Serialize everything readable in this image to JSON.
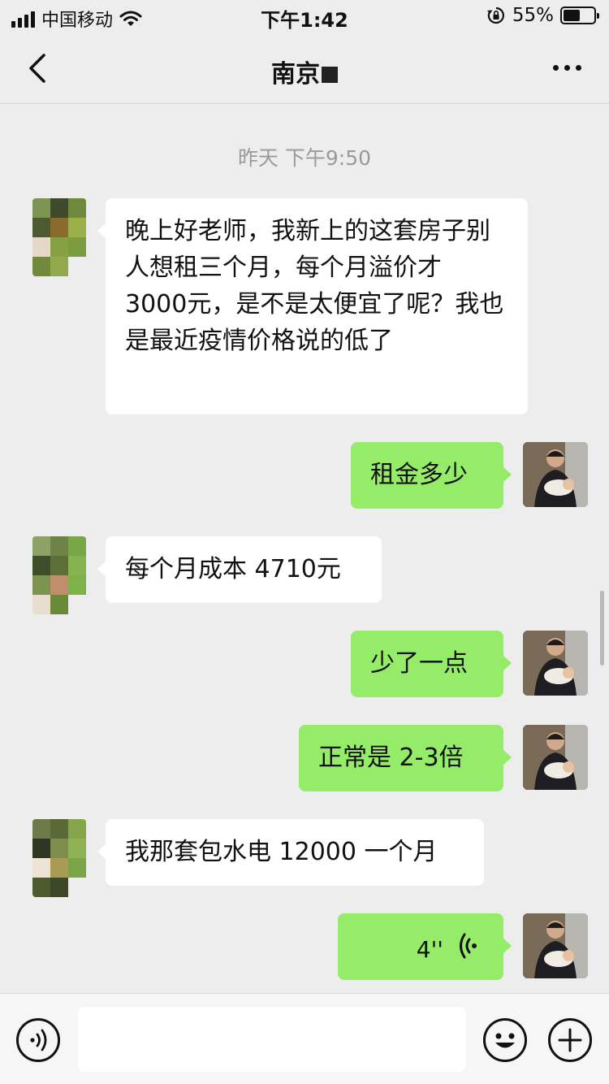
{
  "status_bar": {
    "carrier": "中国移动",
    "time": "下午1:42",
    "battery_percent_label": "55%",
    "battery_level": 0.55,
    "icons": [
      "signal-icon",
      "wifi-icon",
      "rotation-lock-icon",
      "battery-icon"
    ]
  },
  "nav": {
    "title": "南京",
    "back_icon": "chevron-left-icon",
    "more_icon": "more-dots-icon"
  },
  "chat": {
    "timestamp": "昨天 下午9:50",
    "messages": [
      {
        "side": "in",
        "type": "text",
        "text": "晚上好老师，我新上的这套房子别人想租三个月，每个月溢价才 3000元，是不是太便宜了呢？我也是最近疫情价格说的低了"
      },
      {
        "side": "out",
        "type": "text",
        "text": "租金多少"
      },
      {
        "side": "in",
        "type": "text",
        "text": "每个月成本 4710元"
      },
      {
        "side": "out",
        "type": "text",
        "text": "少了一点"
      },
      {
        "side": "out",
        "type": "text",
        "text": "正常是 2-3倍"
      },
      {
        "side": "in",
        "type": "text",
        "text": "我那套包水电 12000 一个月"
      },
      {
        "side": "out",
        "type": "voice",
        "duration": "4''"
      }
    ]
  },
  "input_bar": {
    "placeholder": "",
    "icons": [
      "voice-mode-icon",
      "emoji-icon",
      "plus-icon"
    ]
  },
  "colors": {
    "background": "#ededed",
    "incoming_bubble": "#ffffff",
    "outgoing_bubble": "#95ec69",
    "timestamp": "#9a9a9a"
  }
}
